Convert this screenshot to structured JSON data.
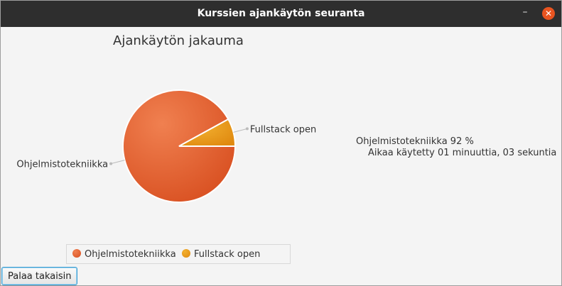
{
  "window": {
    "title": "Kurssien ajankäytön seuranta",
    "minimize_glyph": "–",
    "close_glyph": "✕"
  },
  "chart_data": {
    "type": "pie",
    "title": "Ajankäytön jakauma",
    "categories": [
      "Ohjelmistotekniikka",
      "Fullstack open"
    ],
    "values": [
      92,
      8
    ],
    "colors": [
      "#e0582a",
      "#e89a1c"
    ],
    "legend_position": "bottom"
  },
  "info": {
    "line1": "Ohjelmistotekniikka 92 %",
    "line2": "Aikaa käytetty 01 minuuttia, 03 sekuntia"
  },
  "legend": {
    "items": [
      {
        "label": "Ohjelmistotekniikka",
        "color": "#e0582a"
      },
      {
        "label": "Fullstack open",
        "color": "#e89a1c"
      }
    ]
  },
  "buttons": {
    "back_label": "Palaa takaisin"
  }
}
